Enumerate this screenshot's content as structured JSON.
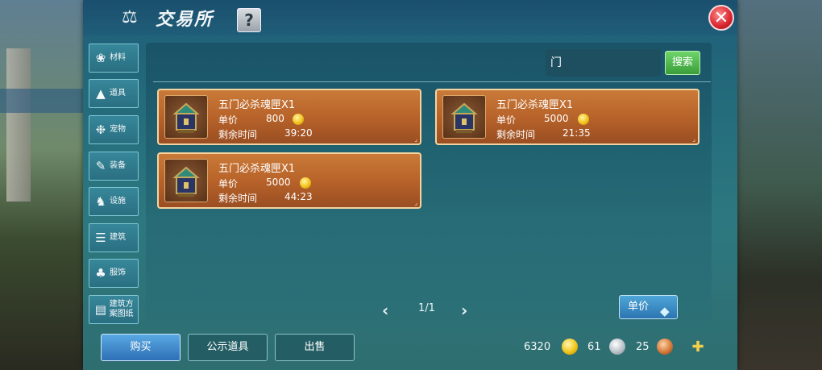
{
  "window": {
    "title": "交易所",
    "help_label": "?",
    "close_label": "✕"
  },
  "sidebar": {
    "items": [
      {
        "label": "材料",
        "icon": "materials-icon"
      },
      {
        "label": "道具",
        "icon": "flask-icon"
      },
      {
        "label": "宠物",
        "icon": "paw-icon"
      },
      {
        "label": "装备",
        "icon": "equipment-icon"
      },
      {
        "label": "设施",
        "icon": "facility-icon"
      },
      {
        "label": "建筑",
        "icon": "building-icon"
      },
      {
        "label": "服饰",
        "icon": "clothing-icon"
      },
      {
        "label": "建筑方案图纸",
        "icon": "blueprint-icon"
      }
    ]
  },
  "search": {
    "value": "门",
    "button_label": "搜索"
  },
  "listings": [
    {
      "name": "五门必杀魂匣X1",
      "price_label": "单价",
      "price": "800",
      "time_label": "剩余时间",
      "time": "39:20"
    },
    {
      "name": "五门必杀魂匣X1",
      "price_label": "单价",
      "price": "5000",
      "time_label": "剩余时间",
      "time": "21:35"
    },
    {
      "name": "五门必杀魂匣X1",
      "price_label": "单价",
      "price": "5000",
      "time_label": "剩余时间",
      "time": "44:23"
    }
  ],
  "pagination": {
    "text": "1/1"
  },
  "sort": {
    "label": "单价"
  },
  "bottom": {
    "buy_label": "购买",
    "showcase_label": "公示道具",
    "sell_label": "出售"
  },
  "currency": {
    "gold": "6320",
    "silver": "61",
    "copper": "25"
  }
}
